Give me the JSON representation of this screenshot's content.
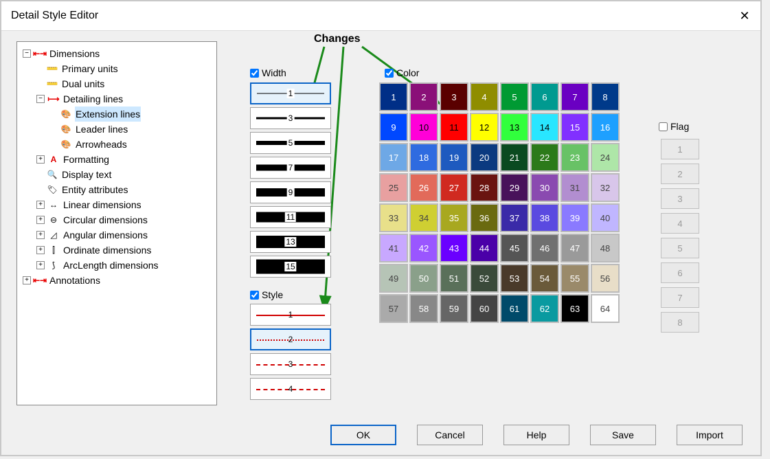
{
  "title": "Detail Style Editor",
  "annotation": "Changes",
  "tree": {
    "dimensions": "Dimensions",
    "primary_units": "Primary units",
    "dual_units": "Dual units",
    "detailing_lines": "Detailing lines",
    "extension_lines": "Extension lines",
    "leader_lines": "Leader lines",
    "arrowheads": "Arrowheads",
    "formatting": "Formatting",
    "display_text": "Display text",
    "entity_attributes": "Entity attributes",
    "linear": "Linear dimensions",
    "circular": "Circular dimensions",
    "angular": "Angular dimensions",
    "ordinate": "Ordinate dimensions",
    "arclength": "ArcLength dimensions",
    "annotations": "Annotations"
  },
  "width": {
    "label": "Width",
    "checked": true,
    "values": [
      "1",
      "3",
      "5",
      "7",
      "9",
      "11",
      "13",
      "15"
    ]
  },
  "style": {
    "label": "Style",
    "checked": true,
    "values": [
      "1",
      "2",
      "3",
      "4"
    ]
  },
  "color": {
    "label": "Color",
    "checked": true,
    "swatches": [
      {
        "n": "1",
        "bg": "#002f87",
        "fg": "#fff"
      },
      {
        "n": "2",
        "bg": "#8a1078",
        "fg": "#fff"
      },
      {
        "n": "3",
        "bg": "#5a0000",
        "fg": "#fff"
      },
      {
        "n": "4",
        "bg": "#8f8d00",
        "fg": "#fff"
      },
      {
        "n": "5",
        "bg": "#009a33",
        "fg": "#fff"
      },
      {
        "n": "6",
        "bg": "#009a90",
        "fg": "#fff"
      },
      {
        "n": "7",
        "bg": "#6a00c2",
        "fg": "#fff"
      },
      {
        "n": "8",
        "bg": "#003a8a",
        "fg": "#fff"
      },
      {
        "n": "9",
        "bg": "#0048ff",
        "fg": "#fff"
      },
      {
        "n": "10",
        "bg": "#ff00d8",
        "fg": "#000"
      },
      {
        "n": "11",
        "bg": "#ff0000",
        "fg": "#000"
      },
      {
        "n": "12",
        "bg": "#ffff00",
        "fg": "#000"
      },
      {
        "n": "13",
        "bg": "#31ff3d",
        "fg": "#000"
      },
      {
        "n": "14",
        "bg": "#29e6ff",
        "fg": "#000"
      },
      {
        "n": "15",
        "bg": "#8130ff",
        "fg": "#fff"
      },
      {
        "n": "16",
        "bg": "#1ea0ff",
        "fg": "#fff"
      },
      {
        "n": "17",
        "bg": "#6ea8e6",
        "fg": "#fff"
      },
      {
        "n": "18",
        "bg": "#2f6be0",
        "fg": "#fff"
      },
      {
        "n": "19",
        "bg": "#1e5abf",
        "fg": "#fff"
      },
      {
        "n": "20",
        "bg": "#0b3a80",
        "fg": "#fff"
      },
      {
        "n": "21",
        "bg": "#0a4a20",
        "fg": "#fff"
      },
      {
        "n": "22",
        "bg": "#2c7a1a",
        "fg": "#fff"
      },
      {
        "n": "23",
        "bg": "#68c266",
        "fg": "#fff"
      },
      {
        "n": "24",
        "bg": "#aee6a8",
        "fg": "#444"
      },
      {
        "n": "25",
        "bg": "#e8a0a0",
        "fg": "#444"
      },
      {
        "n": "26",
        "bg": "#e26a5a",
        "fg": "#fff"
      },
      {
        "n": "27",
        "bg": "#d02a20",
        "fg": "#fff"
      },
      {
        "n": "28",
        "bg": "#6a1410",
        "fg": "#fff"
      },
      {
        "n": "29",
        "bg": "#48125a",
        "fg": "#fff"
      },
      {
        "n": "30",
        "bg": "#8a4ab0",
        "fg": "#fff"
      },
      {
        "n": "31",
        "bg": "#b28ed0",
        "fg": "#444"
      },
      {
        "n": "32",
        "bg": "#d8c6ea",
        "fg": "#444"
      },
      {
        "n": "33",
        "bg": "#e8e08a",
        "fg": "#444"
      },
      {
        "n": "34",
        "bg": "#cfcf32",
        "fg": "#444"
      },
      {
        "n": "35",
        "bg": "#a8a820",
        "fg": "#fff"
      },
      {
        "n": "36",
        "bg": "#6a6a10",
        "fg": "#fff"
      },
      {
        "n": "37",
        "bg": "#3a2aa8",
        "fg": "#fff"
      },
      {
        "n": "38",
        "bg": "#5a4ae0",
        "fg": "#fff"
      },
      {
        "n": "39",
        "bg": "#8a7aff",
        "fg": "#fff"
      },
      {
        "n": "40",
        "bg": "#c0b6ff",
        "fg": "#444"
      },
      {
        "n": "41",
        "bg": "#c8a8ff",
        "fg": "#444"
      },
      {
        "n": "42",
        "bg": "#9a56ff",
        "fg": "#fff"
      },
      {
        "n": "43",
        "bg": "#6a00ff",
        "fg": "#fff"
      },
      {
        "n": "44",
        "bg": "#4a00a8",
        "fg": "#fff"
      },
      {
        "n": "45",
        "bg": "#555555",
        "fg": "#fff"
      },
      {
        "n": "46",
        "bg": "#707070",
        "fg": "#fff"
      },
      {
        "n": "47",
        "bg": "#9a9a9a",
        "fg": "#fff"
      },
      {
        "n": "48",
        "bg": "#c8c8c8",
        "fg": "#444"
      },
      {
        "n": "49",
        "bg": "#b6c4b6",
        "fg": "#444"
      },
      {
        "n": "50",
        "bg": "#8aa08a",
        "fg": "#fff"
      },
      {
        "n": "51",
        "bg": "#5a705a",
        "fg": "#fff"
      },
      {
        "n": "52",
        "bg": "#3a4a3a",
        "fg": "#fff"
      },
      {
        "n": "53",
        "bg": "#4a3a2a",
        "fg": "#fff"
      },
      {
        "n": "54",
        "bg": "#6a5a3a",
        "fg": "#fff"
      },
      {
        "n": "55",
        "bg": "#9a8a6a",
        "fg": "#fff"
      },
      {
        "n": "56",
        "bg": "#e8dec8",
        "fg": "#444"
      },
      {
        "n": "57",
        "bg": "#aaaaaa",
        "fg": "#444"
      },
      {
        "n": "58",
        "bg": "#888888",
        "fg": "#fff"
      },
      {
        "n": "59",
        "bg": "#666666",
        "fg": "#fff"
      },
      {
        "n": "60",
        "bg": "#444444",
        "fg": "#fff"
      },
      {
        "n": "61",
        "bg": "#004a6a",
        "fg": "#fff"
      },
      {
        "n": "62",
        "bg": "#0a9aa0",
        "fg": "#fff"
      },
      {
        "n": "63",
        "bg": "#000000",
        "fg": "#fff"
      },
      {
        "n": "64",
        "bg": "#ffffff",
        "fg": "#444"
      }
    ]
  },
  "flag": {
    "label": "Flag",
    "checked": false,
    "values": [
      "1",
      "2",
      "3",
      "4",
      "5",
      "6",
      "7",
      "8"
    ]
  },
  "buttons": {
    "ok": "OK",
    "cancel": "Cancel",
    "help": "Help",
    "save": "Save",
    "import": "Import"
  }
}
